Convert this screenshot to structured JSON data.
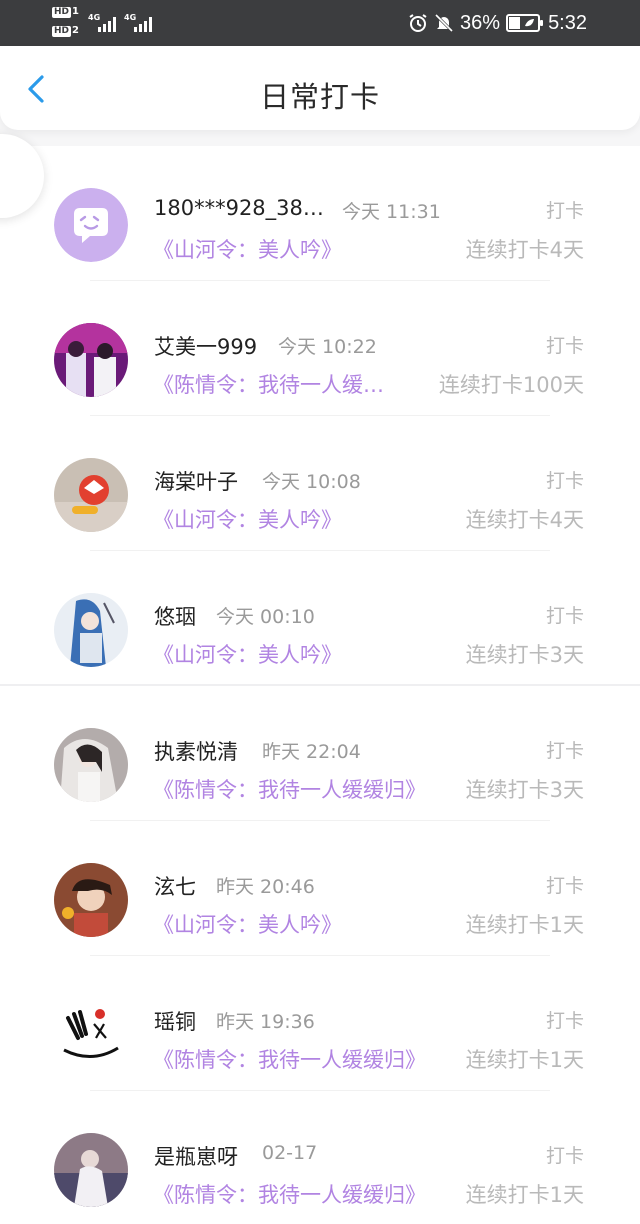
{
  "status": {
    "sim1": "HD",
    "sim1_num": "1",
    "sim2": "HD",
    "sim2_num": "2",
    "net1": "4G",
    "net2": "4G",
    "battery": "36%",
    "time": "5:32"
  },
  "header": {
    "title": "日常打卡",
    "back_icon": "chevron-left-icon"
  },
  "colors": {
    "song": "#b184e2",
    "back": "#2b9bea",
    "muted": "#b9b9b9"
  },
  "items": [
    {
      "name": "180***928_38…",
      "time": "今天 11:31",
      "tag": "打卡",
      "song": "《山河令：美人吟》",
      "streak": "连续打卡4天",
      "avatar": "messenger-bubble-icon"
    },
    {
      "name": "艾美一999",
      "time": "今天 10:22",
      "tag": "打卡",
      "song": "《陈情令：我待一人缓…",
      "streak": "连续打卡100天",
      "avatar": "photo"
    },
    {
      "name": "海棠叶子",
      "time": "今天 10:08",
      "tag": "打卡",
      "song": "《山河令：美人吟》",
      "streak": "连续打卡4天",
      "avatar": "photo"
    },
    {
      "name": "悠珚",
      "time": "今天 00:10",
      "tag": "打卡",
      "song": "《山河令：美人吟》",
      "streak": "连续打卡3天",
      "avatar": "photo"
    },
    {
      "name": "执素悦清",
      "time": "昨天 22:04",
      "tag": "打卡",
      "song": "《陈情令：我待一人缓缓归》",
      "streak": "连续打卡3天",
      "avatar": "photo"
    },
    {
      "name": "泫七",
      "time": "昨天 20:46",
      "tag": "打卡",
      "song": "《山河令：美人吟》",
      "streak": "连续打卡1天",
      "avatar": "photo"
    },
    {
      "name": "瑶铜",
      "time": "昨天 19:36",
      "tag": "打卡",
      "song": "《陈情令：我待一人缓缓归》",
      "streak": "连续打卡1天",
      "avatar": "logo"
    },
    {
      "name": "是瓶崽呀",
      "time": "02-17",
      "tag": "打卡",
      "song": "《陈情令：我待一人缓缓归》",
      "streak": "连续打卡1天",
      "avatar": "photo"
    }
  ]
}
